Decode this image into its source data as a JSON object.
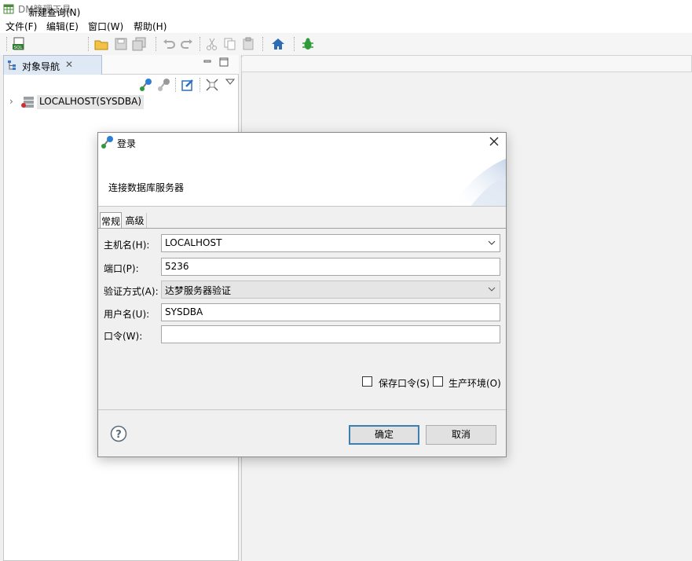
{
  "app": {
    "title": "DM管理工具"
  },
  "menu": {
    "items": [
      "文件(F)",
      "编辑(E)",
      "窗口(W)",
      "帮助(H)"
    ]
  },
  "toolbar": {
    "new_query_label": "新建查询(N)"
  },
  "navigator": {
    "tab_label": "对象导航",
    "tree": [
      {
        "label": "LOCALHOST(SYSDBA)"
      }
    ]
  },
  "dialog": {
    "title": "登录",
    "banner_text": "连接数据库服务器",
    "tabs": [
      "常规",
      "高级"
    ],
    "fields": {
      "host": {
        "label": "主机名(H):",
        "value": "LOCALHOST"
      },
      "port": {
        "label": "端口(P):",
        "value": "5236"
      },
      "auth": {
        "label": "验证方式(A):",
        "value": "达梦服务器验证"
      },
      "user": {
        "label": "用户名(U):",
        "value": "SYSDBA"
      },
      "password": {
        "label": "口令(W):",
        "value": ""
      }
    },
    "checkboxes": {
      "save_password": {
        "label": "保存口令(S)",
        "checked": false
      },
      "production": {
        "label": "生产环境(O)",
        "checked": false
      }
    },
    "buttons": {
      "ok": "确定",
      "cancel": "取消"
    }
  }
}
